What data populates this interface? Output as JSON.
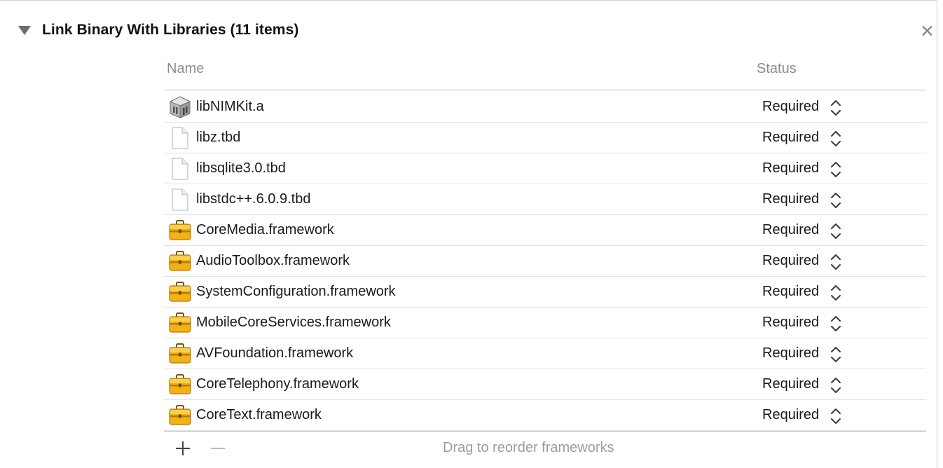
{
  "section": {
    "title": "Link Binary With Libraries (11 items)",
    "close_glyph": "✕"
  },
  "table": {
    "columns": {
      "name": "Name",
      "status": "Status"
    },
    "rows": [
      {
        "name": "libNIMKit.a",
        "status": "Required",
        "icon": "static-library-icon"
      },
      {
        "name": "libz.tbd",
        "status": "Required",
        "icon": "file-icon"
      },
      {
        "name": "libsqlite3.0.tbd",
        "status": "Required",
        "icon": "file-icon"
      },
      {
        "name": "libstdc++.6.0.9.tbd",
        "status": "Required",
        "icon": "file-icon"
      },
      {
        "name": "CoreMedia.framework",
        "status": "Required",
        "icon": "framework-toolbox-icon"
      },
      {
        "name": "AudioToolbox.framework",
        "status": "Required",
        "icon": "framework-toolbox-icon"
      },
      {
        "name": "SystemConfiguration.framework",
        "status": "Required",
        "icon": "framework-toolbox-icon"
      },
      {
        "name": "MobileCoreServices.framework",
        "status": "Required",
        "icon": "framework-toolbox-icon"
      },
      {
        "name": "AVFoundation.framework",
        "status": "Required",
        "icon": "framework-toolbox-icon"
      },
      {
        "name": "CoreTelephony.framework",
        "status": "Required",
        "icon": "framework-toolbox-icon"
      },
      {
        "name": "CoreText.framework",
        "status": "Required",
        "icon": "framework-toolbox-icon"
      }
    ]
  },
  "footer": {
    "hint": "Drag to reorder frameworks"
  },
  "colors": {
    "toolbox_body": "#f2b213",
    "toolbox_dark": "#b47a0a",
    "text": "#1a1a1a",
    "muted": "#8d8d8d"
  }
}
